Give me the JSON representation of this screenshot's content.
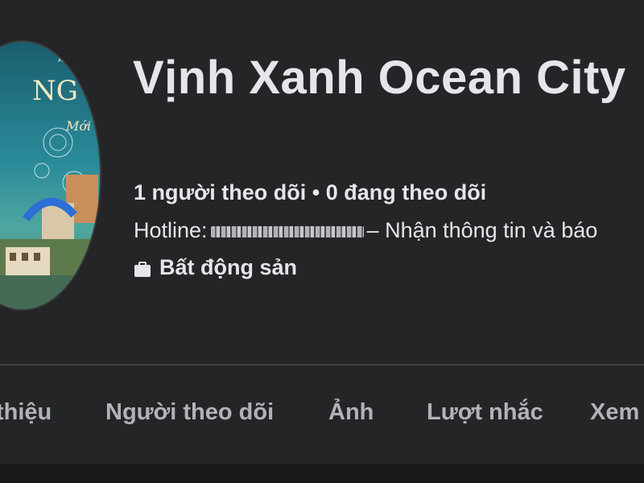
{
  "profile": {
    "title": "Vịnh Xanh Ocean City",
    "stats": "1 người theo dõi • 0 đang theo dõi",
    "hotline_label": "Hotline:",
    "hotline_suffix": "– Nhận thông tin và báo",
    "category": "Bất động sản",
    "category_icon": "briefcase-icon"
  },
  "tabs": [
    {
      "label": "thiệu"
    },
    {
      "label": "Người theo dõi"
    },
    {
      "label": "Ảnh"
    },
    {
      "label": "Lượt nhắc"
    },
    {
      "label": "Xem"
    }
  ],
  "avatar_text": {
    "top_small": "A",
    "line1": "NG",
    "line2": "Mới"
  },
  "colors": {
    "background": "#242526",
    "text_primary": "#e4e6eb",
    "text_secondary": "#b0b3b8",
    "divider": "#3e4042"
  }
}
